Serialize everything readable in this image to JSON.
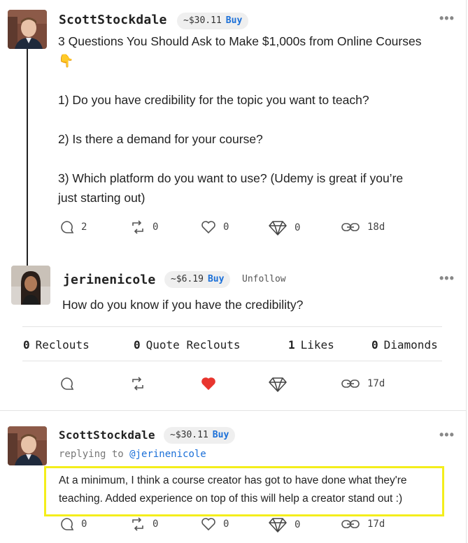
{
  "post1": {
    "username": "ScottStockdale",
    "price": "~$30.11",
    "buy_label": "Buy",
    "more": "•••",
    "line1": "3 Questions You Should Ask to Make $1,000s from Online Courses",
    "emoji": "👇",
    "q1": "1) Do you have credibility for the topic you want to teach?",
    "q2": "2) Is there a demand for your course?",
    "q3a": "3) Which platform do you want to use? (Udemy is great if you’re",
    "q3b": "just starting out)",
    "comments": "2",
    "reclouts": "0",
    "likes": "0",
    "diamonds": "0",
    "age": "18d"
  },
  "post2": {
    "username": "jerinenicole",
    "price": "~$6.19",
    "buy_label": "Buy",
    "unfollow": "Unfollow",
    "more": "•••",
    "body": "How do you know if you have the credibility?",
    "stats": {
      "reclouts_count": "0",
      "reclouts_label": "Reclouts",
      "quote_count": "0",
      "quote_label": "Quote Reclouts",
      "likes_count": "1",
      "likes_label": "Likes",
      "diamonds_count": "0",
      "diamonds_label": "Diamonds"
    },
    "age": "17d"
  },
  "post3": {
    "username": "ScottStockdale",
    "price": "~$30.11",
    "buy_label": "Buy",
    "more": "•••",
    "replying_prefix": "replying to",
    "replying_handle": "@jerinenicole",
    "line1": "At a minimum, I think a course creator has got to have done what they're",
    "line2": "teaching. Added experience on top of this will help a creator stand out :)",
    "comments": "0",
    "reclouts": "0",
    "likes": "0",
    "diamonds": "0",
    "age": "17d"
  },
  "colors": {
    "buy": "#1a6fd8",
    "heart_active": "#e8352e",
    "highlight": "#f4ee1b"
  },
  "icons": [
    "comment-icon",
    "reclout-icon",
    "heart-icon",
    "diamond-icon",
    "link-icon",
    "more-icon",
    "pointing-down-emoji"
  ]
}
